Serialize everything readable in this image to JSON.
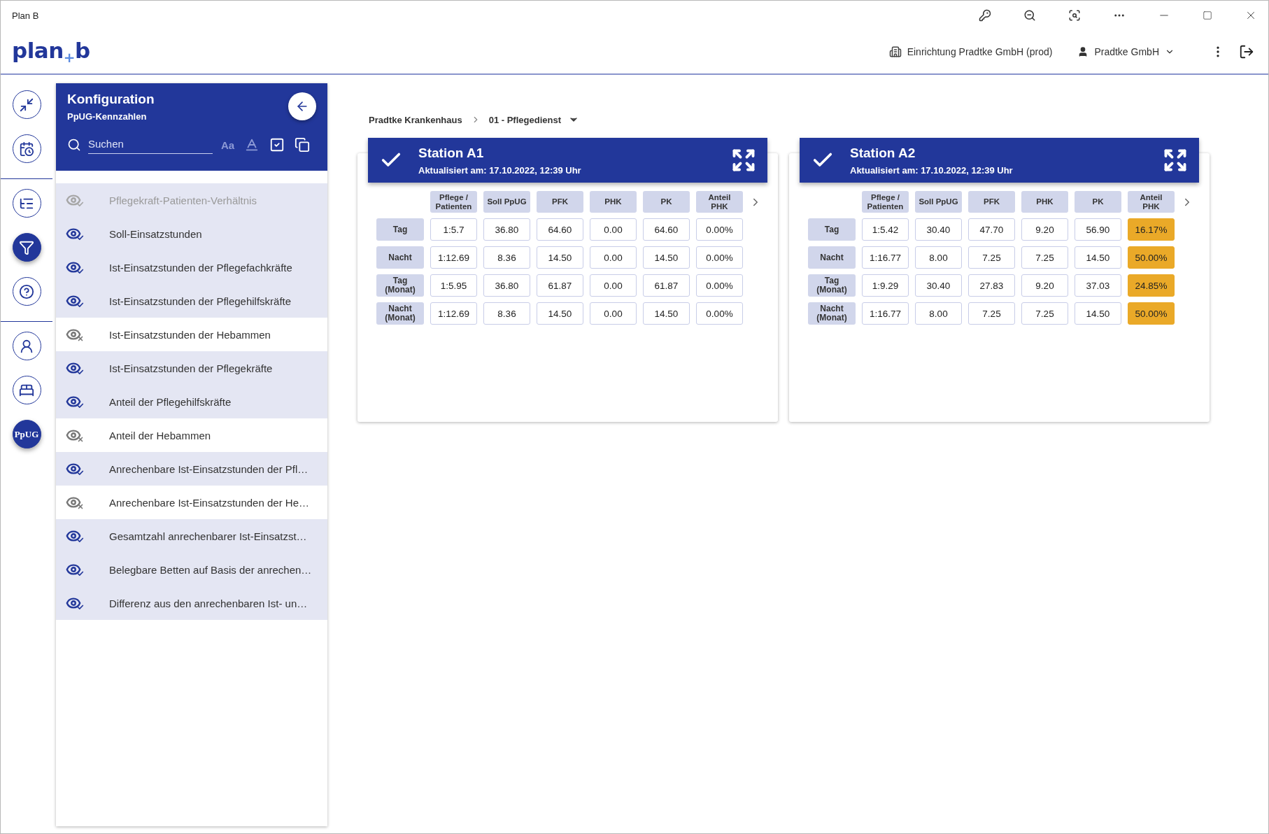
{
  "window": {
    "title": "Plan B"
  },
  "header": {
    "logo": [
      "plan",
      "+",
      "b"
    ],
    "facility": "Einrichtung Pradtke GmbH (prod)",
    "user": "Pradtke GmbH"
  },
  "rail": [
    [
      {
        "kind": "icon",
        "selected": false
      },
      {
        "kind": "icon",
        "selected": false
      }
    ],
    [
      {
        "kind": "icon",
        "selected": false
      },
      {
        "kind": "icon",
        "selected": true
      },
      {
        "kind": "icon",
        "selected": false
      }
    ],
    [
      {
        "kind": "icon",
        "selected": false
      },
      {
        "kind": "icon",
        "selected": false
      },
      {
        "kind": "text",
        "label": "PpUG",
        "selected": true
      }
    ]
  ],
  "panel": {
    "title": "Konfiguration",
    "subtitle": "PpUG-Kennzahlen",
    "search": {
      "placeholder": "Suchen"
    },
    "case_toggle": "Aa",
    "items": [
      {
        "label": "Pflegekraft-Patienten-Verhältnis",
        "visible": true,
        "disabled": true
      },
      {
        "label": "Soll-Einsatzstunden",
        "visible": true,
        "disabled": false
      },
      {
        "label": "Ist-Einsatzstunden der Pflegefachkräfte",
        "visible": true,
        "disabled": false
      },
      {
        "label": "Ist-Einsatzstunden der Pflegehilfskräfte",
        "visible": true,
        "disabled": false
      },
      {
        "label": "Ist-Einsatzstunden der Hebammen",
        "visible": false,
        "disabled": false
      },
      {
        "label": "Ist-Einsatzstunden der Pflegekräfte",
        "visible": true,
        "disabled": false
      },
      {
        "label": "Anteil der Pflegehilfskräfte",
        "visible": true,
        "disabled": false
      },
      {
        "label": "Anteil der Hebammen",
        "visible": false,
        "disabled": false
      },
      {
        "label": "Anrechenbare Ist-Einsatzstunden der Pfl…",
        "visible": true,
        "disabled": false
      },
      {
        "label": "Anrechenbare Ist-Einsatzstunden der He…",
        "visible": false,
        "disabled": false
      },
      {
        "label": "Gesamtzahl anrechenbarer Ist-Einsatzst…",
        "visible": true,
        "disabled": false
      },
      {
        "label": "Belegbare Betten auf Basis der anrechen…",
        "visible": true,
        "disabled": false
      },
      {
        "label": "Differenz aus den anrechenbaren Ist- un…",
        "visible": true,
        "disabled": false
      }
    ]
  },
  "breadcrumb": [
    "Pradtke Krankenhaus",
    "01 - Pflegedienst"
  ],
  "stations": [
    {
      "title": "Station A1",
      "updated": "Aktualisiert am: 17.10.2022, 12:39 Uhr",
      "columns": [
        "Pflege /\nPatienten",
        "Soll PpUG",
        "PFK",
        "PHK",
        "PK",
        "Anteil\nPHK"
      ],
      "rows": [
        {
          "label": "Tag",
          "cells": [
            {
              "value": "1:5.7",
              "highlighted": false
            },
            {
              "value": "36.80",
              "highlighted": false
            },
            {
              "value": "64.60",
              "highlighted": false
            },
            {
              "value": "0.00",
              "highlighted": false
            },
            {
              "value": "64.60",
              "highlighted": false
            },
            {
              "value": "0.00%",
              "highlighted": false
            }
          ]
        },
        {
          "label": "Nacht",
          "cells": [
            {
              "value": "1:12.69",
              "highlighted": false
            },
            {
              "value": "8.36",
              "highlighted": false
            },
            {
              "value": "14.50",
              "highlighted": false
            },
            {
              "value": "0.00",
              "highlighted": false
            },
            {
              "value": "14.50",
              "highlighted": false
            },
            {
              "value": "0.00%",
              "highlighted": false
            }
          ]
        },
        {
          "label": "Tag\n(Monat)",
          "cells": [
            {
              "value": "1:5.95",
              "highlighted": false
            },
            {
              "value": "36.80",
              "highlighted": false
            },
            {
              "value": "61.87",
              "highlighted": false
            },
            {
              "value": "0.00",
              "highlighted": false
            },
            {
              "value": "61.87",
              "highlighted": false
            },
            {
              "value": "0.00%",
              "highlighted": false
            }
          ]
        },
        {
          "label": "Nacht\n(Monat)",
          "cells": [
            {
              "value": "1:12.69",
              "highlighted": false
            },
            {
              "value": "8.36",
              "highlighted": false
            },
            {
              "value": "14.50",
              "highlighted": false
            },
            {
              "value": "0.00",
              "highlighted": false
            },
            {
              "value": "14.50",
              "highlighted": false
            },
            {
              "value": "0.00%",
              "highlighted": false
            }
          ]
        }
      ]
    },
    {
      "title": "Station A2",
      "updated": "Aktualisiert am: 17.10.2022, 12:39 Uhr",
      "columns": [
        "Pflege /\nPatienten",
        "Soll PpUG",
        "PFK",
        "PHK",
        "PK",
        "Anteil\nPHK"
      ],
      "rows": [
        {
          "label": "Tag",
          "cells": [
            {
              "value": "1:5.42",
              "highlighted": false
            },
            {
              "value": "30.40",
              "highlighted": false
            },
            {
              "value": "47.70",
              "highlighted": false
            },
            {
              "value": "9.20",
              "highlighted": false
            },
            {
              "value": "56.90",
              "highlighted": false
            },
            {
              "value": "16.17%",
              "highlighted": true
            }
          ]
        },
        {
          "label": "Nacht",
          "cells": [
            {
              "value": "1:16.77",
              "highlighted": false
            },
            {
              "value": "8.00",
              "highlighted": false
            },
            {
              "value": "7.25",
              "highlighted": false
            },
            {
              "value": "7.25",
              "highlighted": false
            },
            {
              "value": "14.50",
              "highlighted": false
            },
            {
              "value": "50.00%",
              "highlighted": true
            }
          ]
        },
        {
          "label": "Tag\n(Monat)",
          "cells": [
            {
              "value": "1:9.29",
              "highlighted": false
            },
            {
              "value": "30.40",
              "highlighted": false
            },
            {
              "value": "27.83",
              "highlighted": false
            },
            {
              "value": "9.20",
              "highlighted": false
            },
            {
              "value": "37.03",
              "highlighted": false
            },
            {
              "value": "24.85%",
              "highlighted": true
            }
          ]
        },
        {
          "label": "Nacht\n(Monat)",
          "cells": [
            {
              "value": "1:16.77",
              "highlighted": false
            },
            {
              "value": "8.00",
              "highlighted": false
            },
            {
              "value": "7.25",
              "highlighted": false
            },
            {
              "value": "7.25",
              "highlighted": false
            },
            {
              "value": "14.50",
              "highlighted": false
            },
            {
              "value": "50.00%",
              "highlighted": true
            }
          ]
        }
      ]
    }
  ]
}
